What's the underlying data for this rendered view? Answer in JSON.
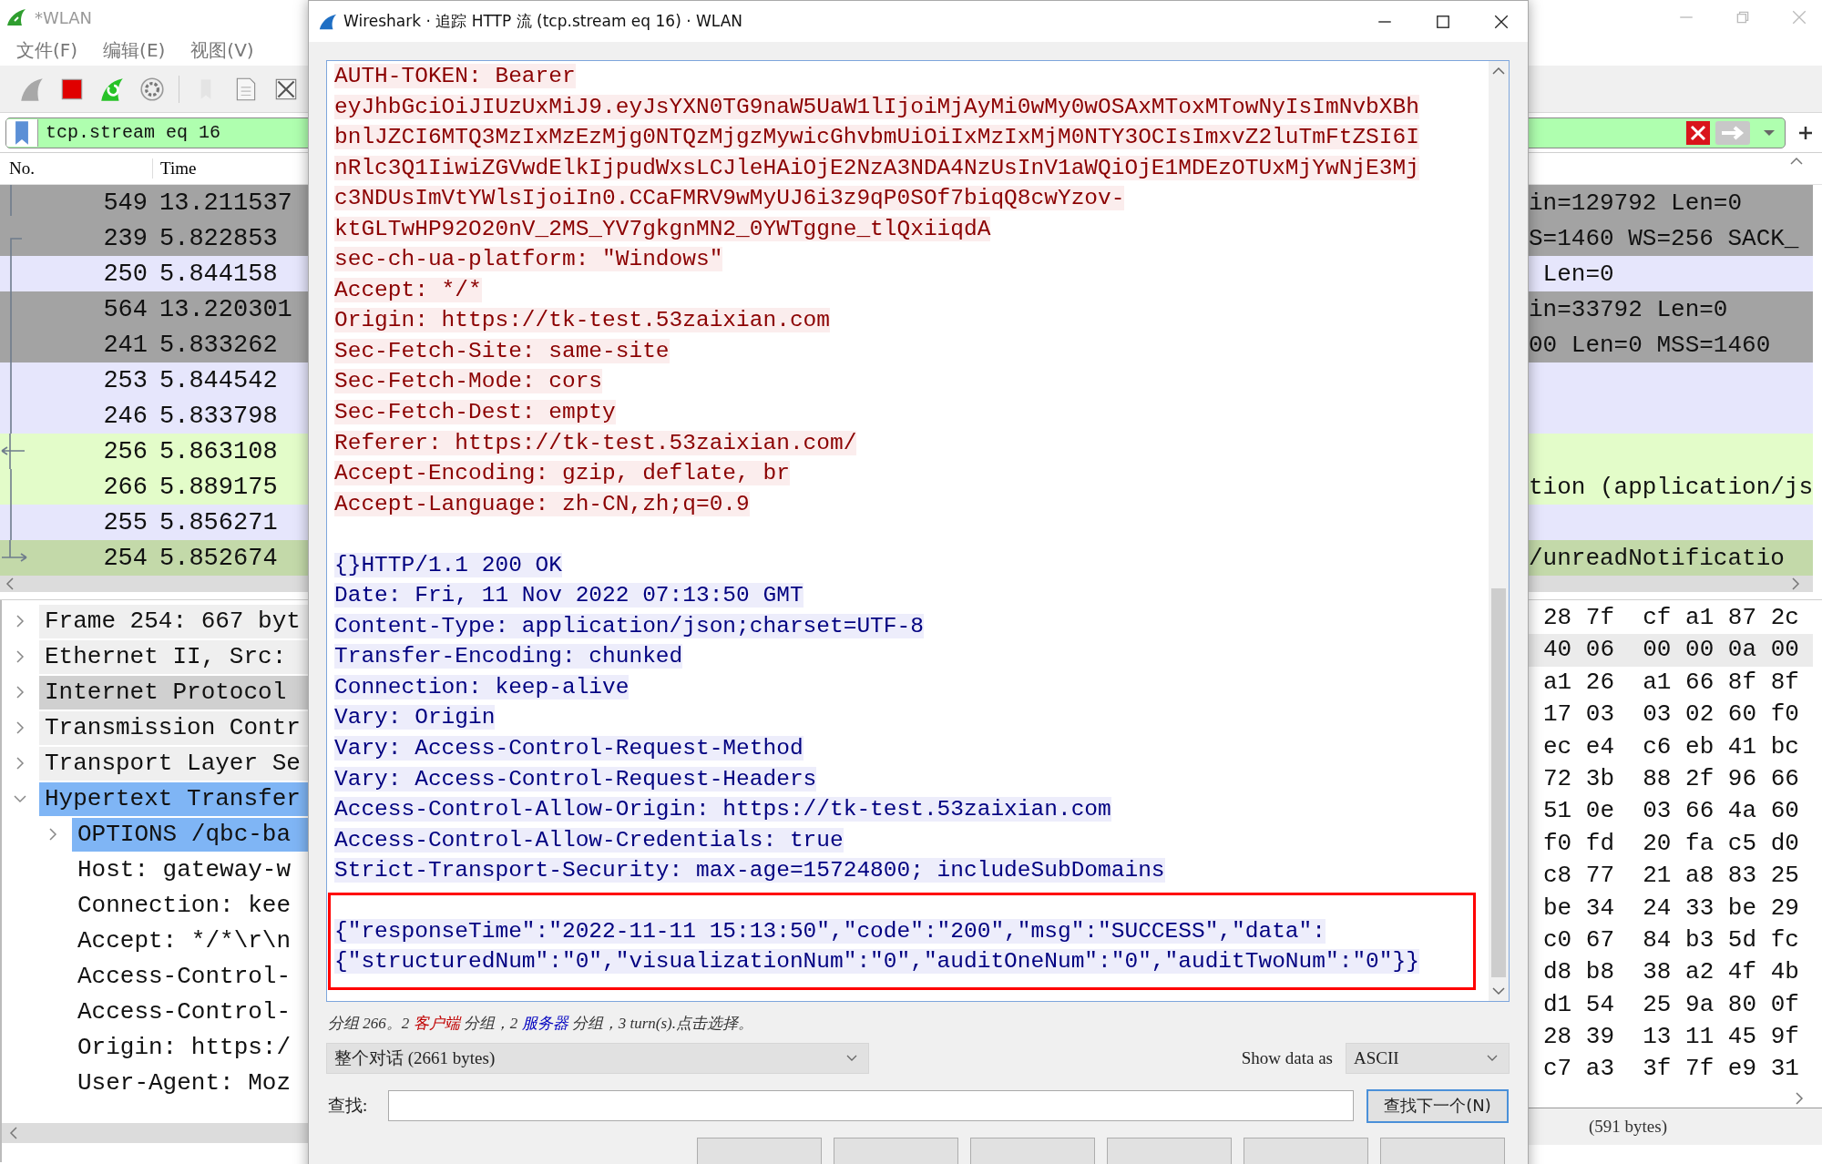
{
  "main_window": {
    "title": "*WLAN"
  },
  "menu": [
    "文件(F)",
    "编辑(E)",
    "视图(V)"
  ],
  "display_filter": {
    "value": "tcp.stream eq 16"
  },
  "packet_list": {
    "columns": [
      "No.",
      "Time"
    ],
    "rows": [
      {
        "no": "549",
        "time": "13.211537",
        "info_tail": "in=129792 Len=0",
        "color": "#a3a3a3",
        "kind": "other"
      },
      {
        "no": "239",
        "time": "5.822853",
        "info_tail": "S=1460 WS=256 SACK_",
        "color": "#a3a3a3",
        "kind": "first"
      },
      {
        "no": "250",
        "time": "5.844158",
        "info_tail": " Len=0",
        "color": "#e6e6fc",
        "kind": "mid"
      },
      {
        "no": "564",
        "time": "13.220301",
        "info_tail": "in=33792 Len=0",
        "color": "#a3a3a3",
        "kind": "mid"
      },
      {
        "no": "241",
        "time": "5.833262",
        "info_tail": "00 Len=0 MSS=1460",
        "color": "#a3a3a3",
        "kind": "mid"
      },
      {
        "no": "253",
        "time": "5.844542",
        "color": "#e6e6fc",
        "kind": "mid"
      },
      {
        "no": "246",
        "time": "5.833798",
        "color": "#e6e6fc",
        "kind": "mid"
      },
      {
        "no": "256",
        "time": "5.863108",
        "color": "#e3fcc9",
        "kind": "response"
      },
      {
        "no": "266",
        "time": "5.889175",
        "info_tail": "tion (application/js",
        "color": "#e3fcc9",
        "kind": "mid"
      },
      {
        "no": "255",
        "time": "5.856271",
        "color": "#e6e6fc",
        "kind": "mid"
      },
      {
        "no": "254",
        "time": "5.852674",
        "info_tail": "/unreadNotificatio",
        "color": "#c3d9a9",
        "kind": "current"
      }
    ]
  },
  "details": {
    "items": [
      {
        "label": "Frame 254: 667 byt",
        "expanded": false,
        "selected": false,
        "hovered": false
      },
      {
        "label": "Ethernet II, Src:",
        "expanded": false,
        "selected": false,
        "hovered": false
      },
      {
        "label": "Internet Protocol",
        "expanded": false,
        "selected": false,
        "hovered": true
      },
      {
        "label": "Transmission Contr",
        "expanded": false,
        "selected": false,
        "hovered": false
      },
      {
        "label": "Transport Layer Se",
        "expanded": false,
        "selected": false,
        "hovered": false
      },
      {
        "label": "Hypertext Transfer",
        "expanded": true,
        "selected": true,
        "hovered": false,
        "children": [
          {
            "label": "OPTIONS /qbc-ba",
            "expanded": false,
            "selected": true,
            "hovered": false
          },
          {
            "label": "Host: gateway-w",
            "selected": false,
            "hovered": false
          },
          {
            "label": "Connection: kee",
            "selected": false,
            "hovered": false
          },
          {
            "label": "Accept: */*\\r\\n",
            "selected": false,
            "hovered": false
          },
          {
            "label": "Access-Control-",
            "selected": false,
            "hovered": false
          },
          {
            "label": "Access-Control-",
            "selected": false,
            "hovered": false
          },
          {
            "label": "Origin: https:/",
            "selected": false,
            "hovered": false
          },
          {
            "label": "User-Agent: Moz",
            "selected": false,
            "hovered": false
          }
        ]
      }
    ]
  },
  "hex": {
    "rows": [
      {
        "bytes": "28 7f  cf a1 87 2c",
        "selected": false
      },
      {
        "bytes": "40 06  00 00 0a 00",
        "selected": true
      },
      {
        "bytes": "a1 26  a1 66 8f 8f",
        "selected": false
      },
      {
        "bytes": "17 03  03 02 60 f0",
        "selected": false
      },
      {
        "bytes": "ec e4  c6 eb 41 bc",
        "selected": false
      },
      {
        "bytes": "72 3b  88 2f 96 66",
        "selected": false
      },
      {
        "bytes": "51 0e  03 66 4a 60",
        "selected": false
      },
      {
        "bytes": "f0 fd  20 fa c5 d0",
        "selected": false
      },
      {
        "bytes": "c8 77  21 a8 83 25",
        "selected": false
      },
      {
        "bytes": "be 34  24 33 be 29",
        "selected": false
      },
      {
        "bytes": "c0 67  84 b3 5d fc",
        "selected": false
      },
      {
        "bytes": "d8 b8  38 a2 4f 4b",
        "selected": false
      },
      {
        "bytes": "d1 54  25 9a 80 0f",
        "selected": false
      },
      {
        "bytes": "28 39  13 11 45 9f",
        "selected": false
      },
      {
        "bytes": "c7 a3  3f 7f e9 31",
        "selected": false
      }
    ],
    "status": "(591 bytes)"
  },
  "dialog": {
    "title": "Wireshark · 追踪 HTTP 流 (tcp.stream eq 16) · WLAN",
    "lines": [
      {
        "kind": "client",
        "text": "AUTH-TOKEN: Bearer"
      },
      {
        "kind": "client",
        "text": "eyJhbGciOiJIUzUxMiJ9.eyJsYXN0TG9naW5UaW1lIjoiMjAyMi0wMy0wOSAxMToxMTowNyIsImNvbXBh"
      },
      {
        "kind": "client",
        "text": "bnlJZCI6MTQ3MzIxMzEzMjg0NTQzMjgzMywicGhvbmUiOiIxMzIxMjM0NTY3OCIsImxvZ2luTmFtZSI6I"
      },
      {
        "kind": "client",
        "text": "nRlc3Q1IiwiZGVwdElkIjpudWxsLCJleHAiOjE2NzA3NDA4NzUsInV1aWQiOjE1MDEzOTUxMjYwNjE3Mj"
      },
      {
        "kind": "client",
        "text": "c3NDUsImVtYWlsIjoiIn0.CCaFMRV9wMyUJ6i3z9qP0SOf7biqQ8cwYzov-"
      },
      {
        "kind": "client",
        "text": "ktGLTwHP92O20nV_2MS_YV7gkgnMN2_0YWTggne_tlQxiiqdA"
      },
      {
        "kind": "client",
        "text": "sec-ch-ua-platform: \"Windows\""
      },
      {
        "kind": "client",
        "text": "Accept: */*"
      },
      {
        "kind": "client",
        "text": "Origin: https://tk-test.53zaixian.com"
      },
      {
        "kind": "client",
        "text": "Sec-Fetch-Site: same-site"
      },
      {
        "kind": "client",
        "text": "Sec-Fetch-Mode: cors"
      },
      {
        "kind": "client",
        "text": "Sec-Fetch-Dest: empty"
      },
      {
        "kind": "client",
        "text": "Referer: https://tk-test.53zaixian.com/"
      },
      {
        "kind": "client",
        "text": "Accept-Encoding: gzip, deflate, br"
      },
      {
        "kind": "client",
        "text": "Accept-Language: zh-CN,zh;q=0.9"
      },
      {
        "kind": "blank"
      },
      {
        "kind": "server",
        "text": "{}HTTP/1.1 200 OK"
      },
      {
        "kind": "server",
        "text": "Date: Fri, 11 Nov 2022 07:13:50 GMT"
      },
      {
        "kind": "server",
        "text": "Content-Type: application/json;charset=UTF-8"
      },
      {
        "kind": "server",
        "text": "Transfer-Encoding: chunked"
      },
      {
        "kind": "server",
        "text": "Connection: keep-alive"
      },
      {
        "kind": "server",
        "text": "Vary: Origin"
      },
      {
        "kind": "server",
        "text": "Vary: Access-Control-Request-Method"
      },
      {
        "kind": "server",
        "text": "Vary: Access-Control-Request-Headers"
      },
      {
        "kind": "server",
        "text": "Access-Control-Allow-Origin: https://tk-test.53zaixian.com"
      },
      {
        "kind": "server",
        "text": "Access-Control-Allow-Credentials: true"
      },
      {
        "kind": "server",
        "text": "Strict-Transport-Security: max-age=15724800; includeSubDomains"
      }
    ],
    "framed_lines": [
      {
        "kind": "server",
        "text": "{\"responseTime\":\"2022-11-11 15:13:50\",\"code\":\"200\",\"msg\":\"SUCCESS\",\"data\":"
      },
      {
        "kind": "server",
        "text": "{\"structuredNum\":\"0\",\"visualizationNum\":\"0\",\"auditOneNum\":\"0\",\"auditTwoNum\":\"0\"}}"
      }
    ],
    "summary": [
      {
        "kind": "plain",
        "text": "分组 266。2 "
      },
      {
        "kind": "client",
        "text": "客户端"
      },
      {
        "kind": "plain",
        "text": " 分组，2 "
      },
      {
        "kind": "server",
        "text": "服务器"
      },
      {
        "kind": "plain",
        "text": " 分组，3 turn(s).点击选择。"
      }
    ],
    "conversation_select": "整个对话 (2661 bytes)",
    "show_data_label": "Show data as",
    "show_data_select": "ASCII",
    "find_label": "查找:",
    "find_button": "查找下一个(N)"
  }
}
